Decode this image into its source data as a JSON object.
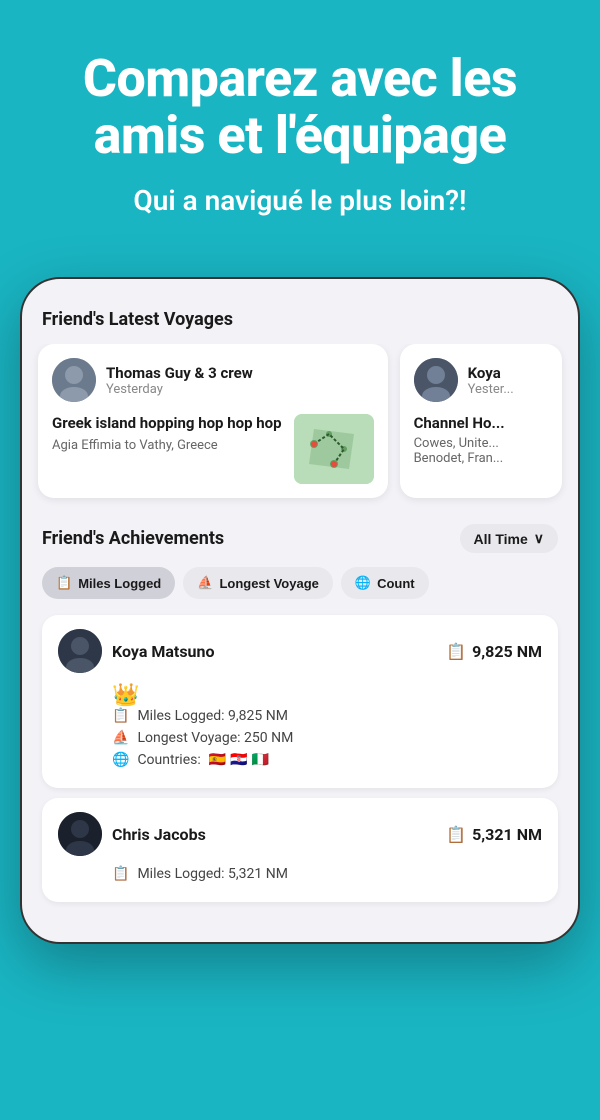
{
  "hero": {
    "title": "Comparez avec les amis et l'équipage",
    "subtitle": "Qui a navigué le plus loin?!"
  },
  "voyages_section": {
    "title": "Friend's Latest Voyages",
    "cards": [
      {
        "user_name": "Thomas Guy & 3 crew",
        "time": "Yesterday",
        "voyage_title": "Greek island hopping hop hop hop",
        "voyage_route": "Agia Effimia to Vathy, Greece"
      },
      {
        "user_name": "Koya",
        "time": "Yester...",
        "voyage_title": "Channel Ho...",
        "voyage_route": "Cowes, Unite... Benodet, Fran..."
      }
    ]
  },
  "achievements_section": {
    "title": "Friend's Achievements",
    "filter": "All Time",
    "tabs": [
      {
        "label": "Miles Logged",
        "icon": "list"
      },
      {
        "label": "Longest Voyage",
        "icon": "compass"
      },
      {
        "label": "Count",
        "icon": "globe"
      }
    ],
    "leaders": [
      {
        "name": "Koya Matsuno",
        "miles": "9,825 NM",
        "is_first": true,
        "stats": [
          {
            "icon": "list",
            "text": "Miles Logged: 9,825 NM"
          },
          {
            "icon": "compass",
            "text": "Longest Voyage: 250 NM"
          },
          {
            "icon": "globe",
            "text": "Countries:",
            "flags": [
              "🇪🇸",
              "🇭🇷",
              "🇮🇹"
            ]
          }
        ]
      },
      {
        "name": "Chris Jacobs",
        "miles": "5,321 NM",
        "is_first": false,
        "stats": [
          {
            "icon": "list",
            "text": "Miles Logged: 5,321 NM"
          }
        ]
      }
    ]
  },
  "icons": {
    "list": "📋",
    "compass": "⛵",
    "globe": "🌐",
    "crown": "👑",
    "chevron_down": "∨"
  }
}
